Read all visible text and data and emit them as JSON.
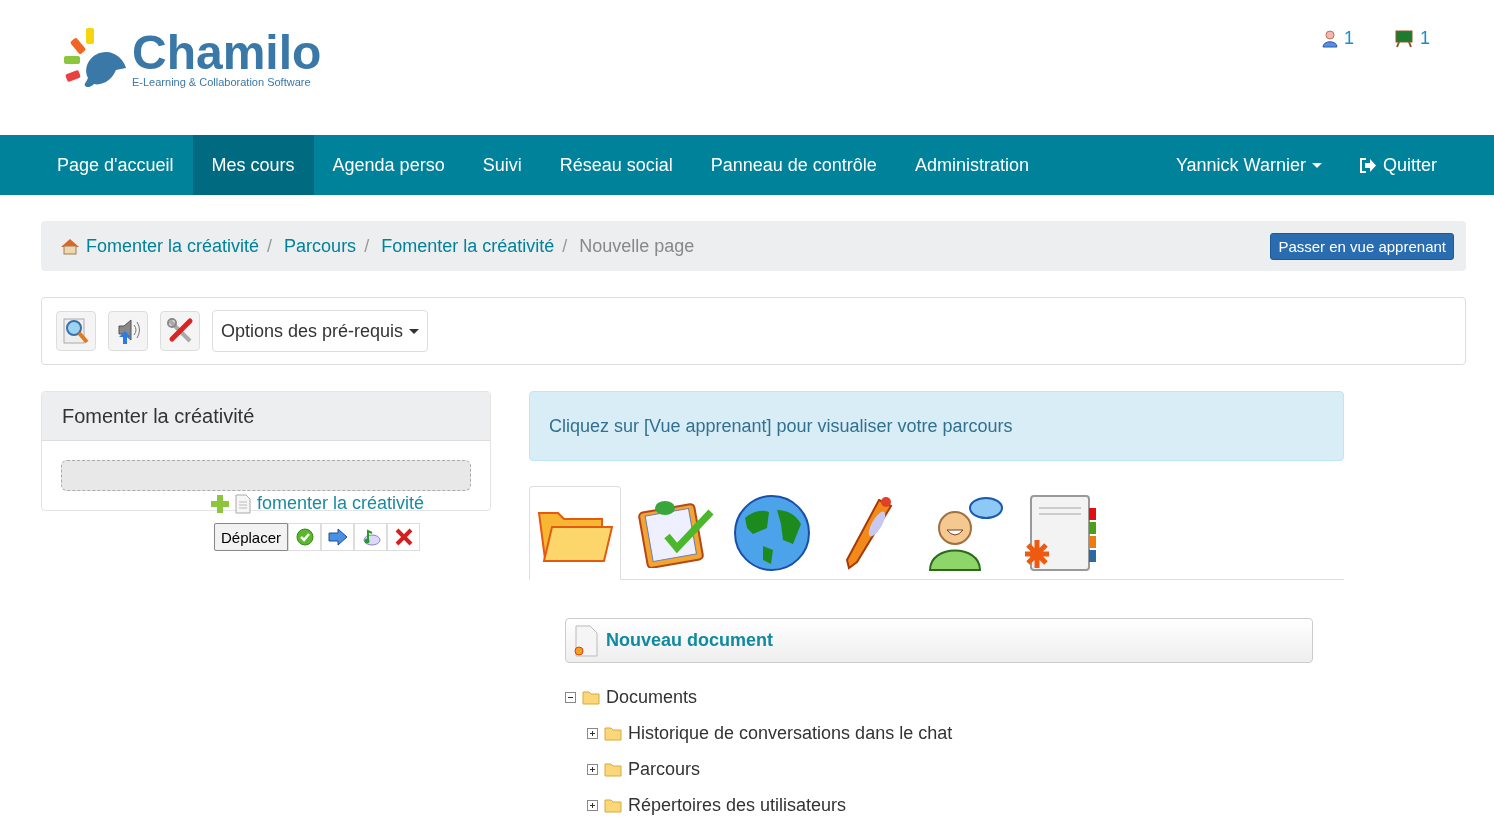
{
  "logo": {
    "name": "Chamilo",
    "tagline": "E-Learning & Collaboration Software"
  },
  "header_counters": [
    {
      "kind": "users",
      "count": "1"
    },
    {
      "kind": "courses",
      "count": "1"
    }
  ],
  "nav": {
    "items": [
      {
        "label": "Page d'accueil",
        "selected": false
      },
      {
        "label": "Mes cours",
        "selected": true
      },
      {
        "label": "Agenda perso",
        "selected": false
      },
      {
        "label": "Suivi",
        "selected": false
      },
      {
        "label": "Réseau social",
        "selected": false
      },
      {
        "label": "Panneau de contrôle",
        "selected": false
      },
      {
        "label": "Administration",
        "selected": false
      }
    ],
    "user_menu": "Yannick Warnier",
    "logout": "Quitter"
  },
  "breadcrumb": {
    "items": [
      "Fomenter la créativité",
      "Parcours",
      "Fomenter la créativité"
    ],
    "separator": "/",
    "current": "Nouvelle page",
    "button": "Passer en vue apprenant"
  },
  "toolbar": {
    "icons": [
      {
        "kind": "search"
      },
      {
        "kind": "audio"
      },
      {
        "kind": "settings"
      }
    ],
    "dropdown": "Options des pré-requis"
  },
  "left_panel": {
    "title": "Fomenter la créativité",
    "item": "fomenter la créativité",
    "move_button": "Déplacer",
    "actions": [
      {
        "kind": "check"
      },
      {
        "kind": "arrow"
      },
      {
        "kind": "audio"
      },
      {
        "kind": "delete"
      }
    ]
  },
  "info_message": "Cliquez sur [Vue apprenant] pour visualiser votre parcours",
  "tabs": [
    {
      "kind": "folder",
      "selected": true
    },
    {
      "kind": "quiz",
      "selected": false
    },
    {
      "kind": "link",
      "selected": false
    },
    {
      "kind": "assignment",
      "selected": false
    },
    {
      "kind": "forum",
      "selected": false
    },
    {
      "kind": "section",
      "selected": false
    }
  ],
  "new_document": "Nouveau document",
  "tree": {
    "label": "Documents",
    "expanded": true,
    "children": [
      {
        "label": "Historique de conversations dans le chat",
        "expanded": false
      },
      {
        "label": "Parcours",
        "expanded": false
      },
      {
        "label": "Répertoires des utilisateurs",
        "expanded": false
      }
    ]
  }
}
